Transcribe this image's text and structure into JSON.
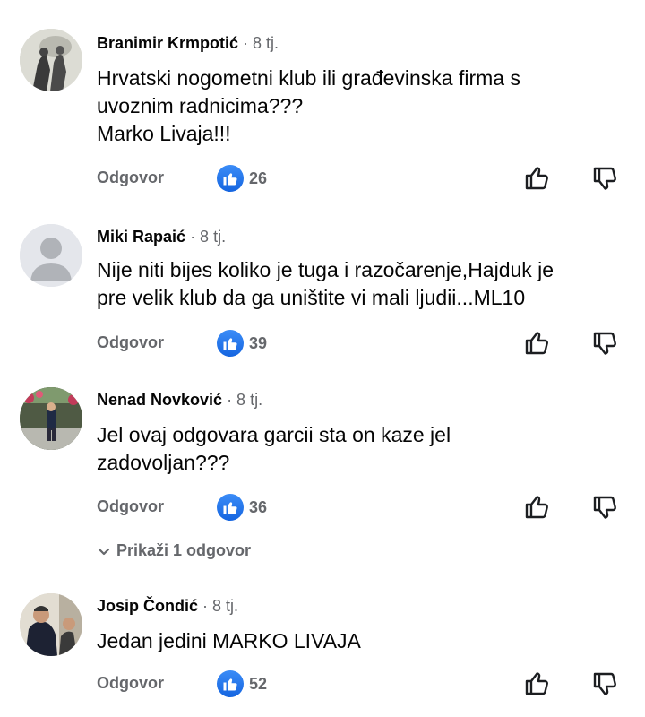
{
  "comments": [
    {
      "author": "Branimir Krmpotić",
      "time": "· 8 tj.",
      "text_lines": [
        "Hrvatski nogometni klub ili građevinska firma s",
        "uvoznim radnicima???",
        "Marko Livaja!!!"
      ],
      "reply_label": "Odgovor",
      "likes": "26"
    },
    {
      "author": "Miki Rapaić",
      "time": "· 8 tj.",
      "text_lines": [
        "Nije niti bijes koliko je tuga i razočarenje,Hajduk je",
        "pre velik klub da ga uništite vi mali ljudii...ML10"
      ],
      "reply_label": "Odgovor",
      "likes": "39"
    },
    {
      "author": "Nenad Novković",
      "time": "· 8 tj.",
      "text_lines": [
        "Jel ovaj odgovara garcii sta on kaze jel",
        "zadovoljan???"
      ],
      "reply_label": "Odgovor",
      "likes": "36",
      "show_replies": "Prikaži 1 odgovor"
    },
    {
      "author": "Josip Čondić",
      "time": "· 8 tj.",
      "text_lines": [
        "Jedan jedini MARKO LIVAJA"
      ],
      "reply_label": "Odgovor",
      "likes": "52"
    }
  ],
  "colors": {
    "like_blue": "#1877f2",
    "secondary_text": "#65676b"
  },
  "icons": [
    "like-icon",
    "thumb-up-icon",
    "thumb-down-icon",
    "chevron-down-icon",
    "default-avatar-icon"
  ]
}
